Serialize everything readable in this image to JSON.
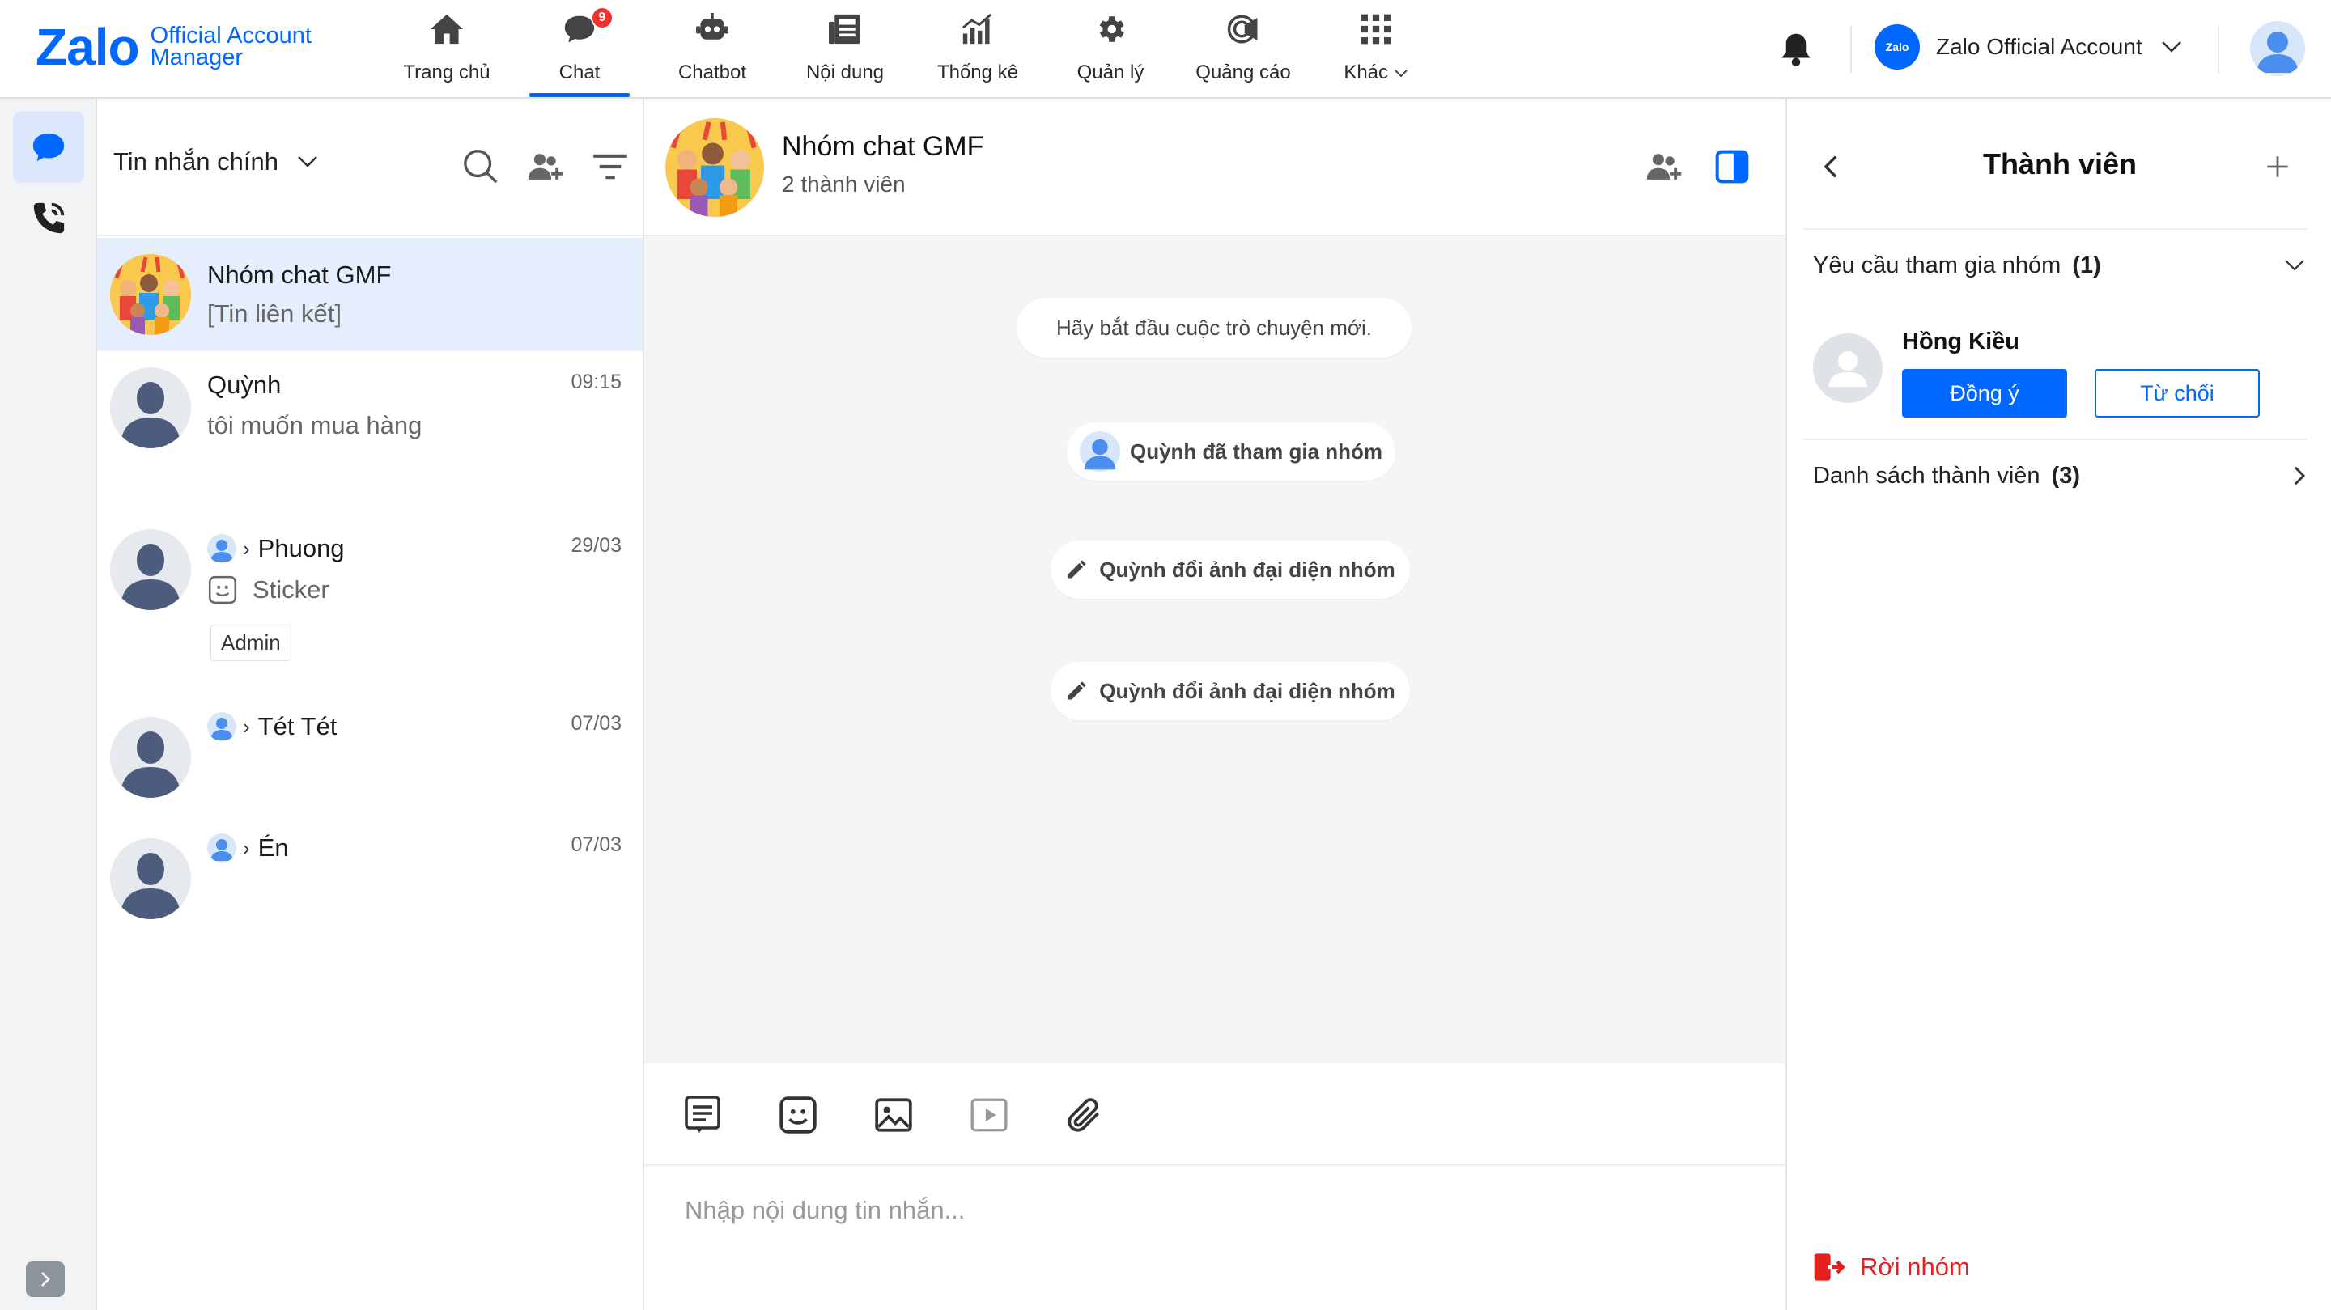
{
  "header": {
    "logo_word": "Zalo",
    "logo_line1": "Official Account",
    "logo_line2": "Manager",
    "nav": [
      {
        "label": "Trang chủ",
        "icon": "home-icon"
      },
      {
        "label": "Chat",
        "icon": "chat-icon",
        "badge": "9"
      },
      {
        "label": "Chatbot",
        "icon": "bot-icon"
      },
      {
        "label": "Nội dung",
        "icon": "newspaper-icon"
      },
      {
        "label": "Thống kê",
        "icon": "stats-icon"
      },
      {
        "label": "Quản lý",
        "icon": "gear-icon"
      },
      {
        "label": "Quảng cáo",
        "icon": "megaphone-icon"
      },
      {
        "label": "Khác",
        "icon": "grid-icon"
      }
    ],
    "account_logo": "Zalo",
    "account_name": "Zalo Official Account"
  },
  "conversation_list": {
    "title": "Tin nhắn chính",
    "items": [
      {
        "name": "Nhóm chat GMF",
        "preview": "[Tin liên kết]",
        "time": ""
      },
      {
        "name": "Quỳnh",
        "preview": "tôi muốn mua hàng",
        "time": "09:15"
      },
      {
        "name": "Phuong",
        "preview": "Sticker",
        "time": "29/03",
        "tag": "Admin"
      },
      {
        "name": "Tét Tét",
        "preview": "",
        "time": "07/03"
      },
      {
        "name": "Én",
        "preview": "",
        "time": "07/03"
      }
    ]
  },
  "chat": {
    "name": "Nhóm chat GMF",
    "subtitle": "2 thành viên",
    "system_messages": [
      "Hãy bắt đầu cuộc trò chuyện mới.",
      "Quỳnh đã tham gia nhóm",
      "Quỳnh đổi ảnh đại diện nhóm",
      "Quỳnh đổi ảnh đại diện nhóm"
    ],
    "input_placeholder": "Nhập nội dung tin nhắn..."
  },
  "panel": {
    "title": "Thành viên",
    "join_requests_label": "Yêu cầu tham gia nhóm",
    "join_requests_count": "(1)",
    "requester_name": "Hồng Kiều",
    "accept_label": "Đồng ý",
    "reject_label": "Từ chối",
    "members_label": "Danh sách thành viên",
    "members_count": "(3)",
    "leave_label": "Rời nhóm"
  },
  "colors": {
    "accent": "#0068ff",
    "danger": "#e5211d",
    "badge": "#f0312f"
  }
}
